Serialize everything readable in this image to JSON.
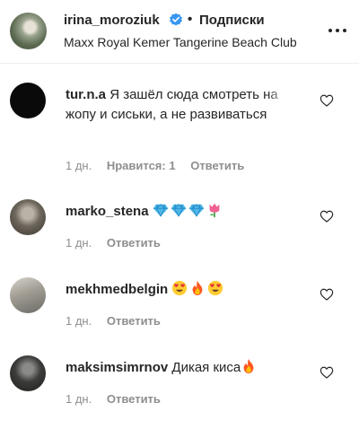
{
  "header": {
    "username": "irina_moroziuk",
    "dot": "•",
    "follow_label": "Подписки",
    "location": "Maxx Royal Kemer Tangerine Beach Club",
    "verified_icon": "verified-badge-icon",
    "more_icon": "more-options-icon"
  },
  "comments": [
    {
      "username": "tur.n.a",
      "text": "Я зашёл сюда смотреть на жопу и сиськи, а не развиваться",
      "time": "1 дн.",
      "likes": "Нравится: 1",
      "reply": "Ответить"
    },
    {
      "username": "marko_stena",
      "text": "",
      "emojis": [
        "gem",
        "gem",
        "gem",
        "tulip"
      ],
      "time": "1 дн.",
      "reply": "Ответить"
    },
    {
      "username": "mekhmedbelgin",
      "text": "",
      "emojis": [
        "heart-eyes",
        "fire",
        "heart-eyes"
      ],
      "time": "1 дн.",
      "reply": "Ответить"
    },
    {
      "username": "maksimsimrnov",
      "text": "Дикая киса",
      "emojis": [
        "fire"
      ],
      "time": "1 дн.",
      "reply": "Ответить"
    }
  ],
  "colors": {
    "text": "#262626",
    "secondary": "#8e8e8e",
    "verified": "#3897f0",
    "border": "#efefef"
  }
}
